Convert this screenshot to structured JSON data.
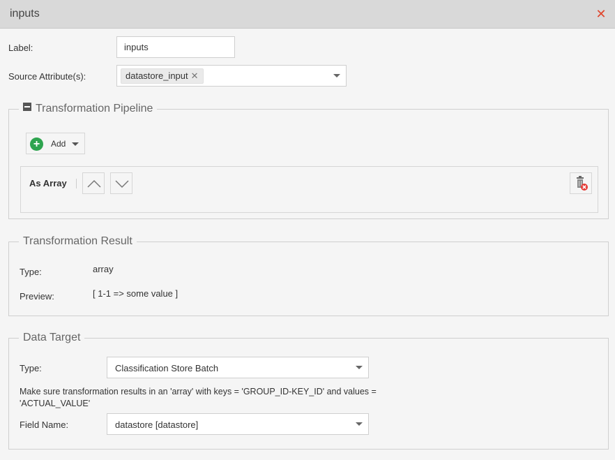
{
  "window": {
    "title": "inputs"
  },
  "general": {
    "label_caption": "Label:",
    "label_value": "inputs",
    "source_caption": "Source Attribute(s):",
    "source_tag": "datastore_input",
    "source_tag_remove": "✕"
  },
  "pipeline": {
    "legend": "Transformation Pipeline",
    "add_label": "Add",
    "step": {
      "title": "As Array"
    }
  },
  "result": {
    "legend": "Transformation Result",
    "type_caption": "Type:",
    "type_value": "array",
    "preview_caption": "Preview:",
    "preview_value": "[ 1-1 => some value ]"
  },
  "target": {
    "legend": "Data Target",
    "type_caption": "Type:",
    "type_value": "Classification Store Batch",
    "note": "Make sure transformation results in an 'array' with keys = 'GROUP_ID-KEY_ID' and values = 'ACTUAL_VALUE'",
    "field_caption": "Field Name:",
    "field_value": "datastore [datastore]"
  },
  "colors": {
    "close": "#e0452c",
    "add": "#2ea44f",
    "delete": "#e53935"
  }
}
